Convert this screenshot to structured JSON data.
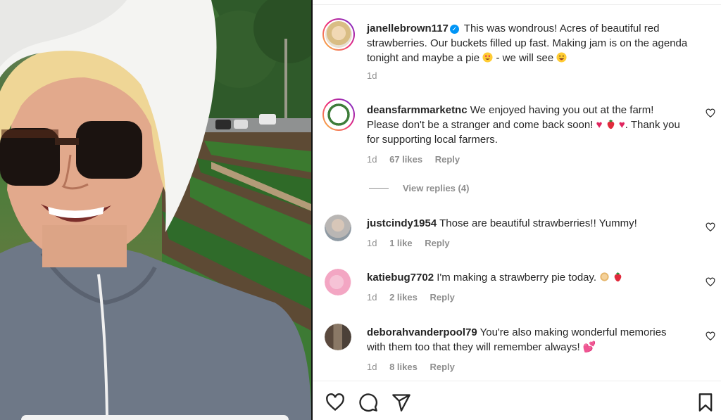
{
  "post": {
    "author": "janellebrown117",
    "caption": "This was wondrous! Acres of beautiful red strawberries. Our buckets filled up fast. Making jam is on the agenda tonight and maybe a pie",
    "caption_tail": "- we will see",
    "time": "1d"
  },
  "comments": [
    {
      "user": "deansfarmmarketnc",
      "text_a": "We enjoyed having you out at the farm! Please don't be a stranger and come back soon!",
      "text_b": "Thank you for supporting local farmers.",
      "time": "1d",
      "likes": "67 likes",
      "reply": "Reply",
      "view_replies": "View replies (4)"
    },
    {
      "user": "justcindy1954",
      "text": "Those are beautiful strawberries!! Yummy!",
      "time": "1d",
      "likes": "1 like",
      "reply": "Reply"
    },
    {
      "user": "katiebug7702",
      "text": "I'm making a strawberry pie today.",
      "time": "1d",
      "likes": "2 likes",
      "reply": "Reply"
    },
    {
      "user": "deborahvanderpool79",
      "text": "You're also making wonderful memories with them too that they will remember always!",
      "time": "1d",
      "likes": "8 likes",
      "reply": "Reply"
    }
  ],
  "colors": {
    "verified": "#0095f6",
    "meta_text": "#8e8e8e",
    "heart": "#e0245e"
  },
  "icons": [
    "heart-icon",
    "comment-icon",
    "share-icon",
    "bookmark-icon",
    "verified-icon"
  ]
}
